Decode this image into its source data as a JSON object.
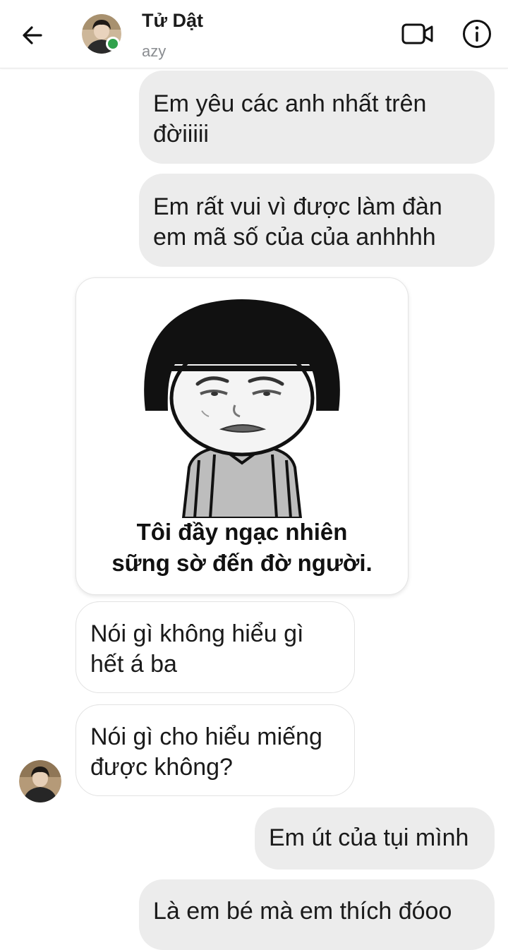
{
  "header": {
    "back_icon": "arrow-left-icon",
    "contact_name": "Tử Dật",
    "contact_subtitle": "azy",
    "online_status_color": "#31a24c",
    "video_call_icon": "video-camera-icon",
    "info_icon": "info-circle-icon"
  },
  "messages": [
    {
      "direction": "sent",
      "lines": [
        "Em yêu các anh nhất trên",
        "đờiiiii"
      ]
    },
    {
      "direction": "sent",
      "lines": [
        "Em rất vui vì được làm đàn",
        "em mã số của của anhhhh"
      ]
    },
    {
      "direction": "received",
      "type": "sticker",
      "caption_lines": [
        "Tôi đầy ngạc nhiên",
        "sững sờ đến đờ người."
      ]
    },
    {
      "direction": "received",
      "lines": [
        "Nói gì không hiểu gì",
        "hết á ba"
      ]
    },
    {
      "direction": "received",
      "lines": [
        "Nói gì cho hiểu miếng",
        "được không?"
      ]
    },
    {
      "direction": "sent",
      "lines": [
        "Em út của tụi mình"
      ]
    },
    {
      "direction": "sent",
      "lines": [
        "Là em bé mà em thích đóoo"
      ]
    }
  ],
  "colors": {
    "sent_bubble": "#ececec",
    "received_bubble": "#ffffff",
    "text": "#1a1a1a",
    "subtitle": "#8a8d91"
  }
}
